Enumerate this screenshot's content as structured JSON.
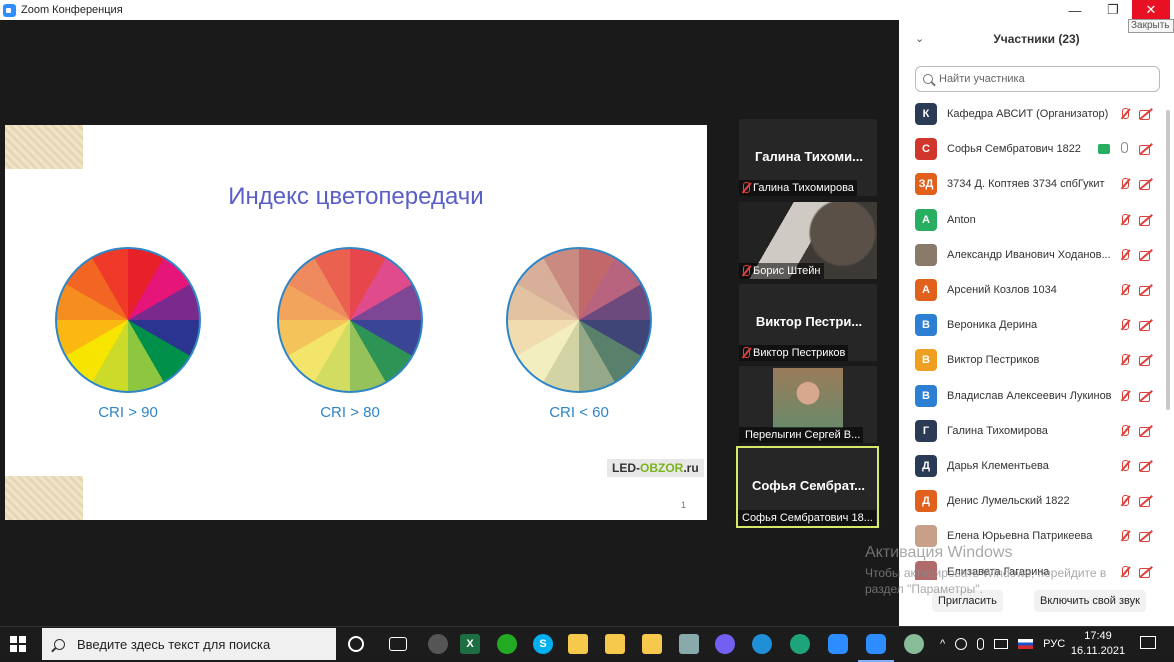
{
  "window": {
    "title": "Zoom Конференция",
    "close_tooltip": "Закрыть",
    "min_glyph": "—",
    "max_glyph": "❐",
    "close_glyph": "✕"
  },
  "slide": {
    "title": "Индекс цветопередачи",
    "wheels": [
      {
        "label": "CRI > 90",
        "colors": [
          "#e8202a",
          "#e5157a",
          "#7a2a8c",
          "#2b3590",
          "#00904a",
          "#8dc63f",
          "#ccdb2a",
          "#f7e500",
          "#fbb813",
          "#f58d1f",
          "#f26522",
          "#ef3a2a"
        ]
      },
      {
        "label": "CRI > 80",
        "colors": [
          "#e6464c",
          "#e04b8c",
          "#7d4795",
          "#3a4596",
          "#2e9455",
          "#95c25a",
          "#d2dc60",
          "#f3e46a",
          "#f4c35a",
          "#f2a35c",
          "#ef8a5e",
          "#ea6150"
        ]
      },
      {
        "label": "CRI < 60",
        "colors": [
          "#c2686a",
          "#b9647e",
          "#6c4a7d",
          "#3f4577",
          "#58806a",
          "#95a888",
          "#d2d4a6",
          "#f3eec0",
          "#f0dcae",
          "#e3c2a2",
          "#d8b09a",
          "#c98a82"
        ]
      }
    ],
    "brand_a": "LED-",
    "brand_b": "OBZOR",
    "brand_c": ".ru",
    "page_number": "1"
  },
  "tiles": [
    {
      "big": "Галина  Тихоми...",
      "caption": "Галина Тихомирова",
      "muted": true
    },
    {
      "big": "",
      "caption": "Борис Штейн",
      "muted": true
    },
    {
      "big": "Виктор  Пестри...",
      "caption": "Виктор Пестриков",
      "muted": true
    },
    {
      "big": "",
      "caption": "Перелыгин Сергей В...",
      "muted": false
    },
    {
      "big": "Софья  Сембрат...",
      "caption": "Софья Сембратович 18...",
      "muted": false
    }
  ],
  "participants_panel": {
    "header_chevron": "⌄",
    "title": "Участники (23)",
    "search_placeholder": "Найти участника",
    "participants": [
      {
        "initial": "К",
        "color": "#2b3a55",
        "name": "Кафедра АВСИТ (Организатор)"
      },
      {
        "initial": "С",
        "color": "#d0362b",
        "name": "Софья Сембратович 1822"
      },
      {
        "initial": "ЗД",
        "color": "#e0601c",
        "name": "3734 Д. Коптяев 3734 спбГукит"
      },
      {
        "initial": "A",
        "color": "#27ae60",
        "name": "Anton"
      },
      {
        "initial": "",
        "color": "#8a7a6a",
        "name": "Александр Иванович Ходанов..."
      },
      {
        "initial": "А",
        "color": "#e0601c",
        "name": "Арсений Козлов 1034"
      },
      {
        "initial": "В",
        "color": "#2d7fd3",
        "name": "Вероника Дерина"
      },
      {
        "initial": "В",
        "color": "#f0a020",
        "name": "Виктор Пестриков"
      },
      {
        "initial": "В",
        "color": "#2d7fd3",
        "name": "Владислав Алексеевич Лукинов"
      },
      {
        "initial": "Г",
        "color": "#2b3a55",
        "name": "Галина Тихомирова"
      },
      {
        "initial": "Д",
        "color": "#2b3a55",
        "name": "Дарья Клементьева"
      },
      {
        "initial": "Д",
        "color": "#e0601c",
        "name": "Денис Лумельский 1822"
      },
      {
        "initial": "",
        "color": "#c8a08a",
        "name": "Елена Юрьевна Патрикеева"
      },
      {
        "initial": "",
        "color": "#b06a6a",
        "name": "Елизавета Гагарина"
      }
    ],
    "invite_label": "Пригласить",
    "unmute_label": "Включить свой звук"
  },
  "activation": {
    "title": "Активация Windows",
    "text": "Чтобы активировать Windows, перейдите в раздел \"Параметры\"."
  },
  "taskbar": {
    "search_placeholder": "Введите здесь текст для поиска",
    "language": "РУС",
    "time": "17:49",
    "date": "16.11.2021"
  }
}
